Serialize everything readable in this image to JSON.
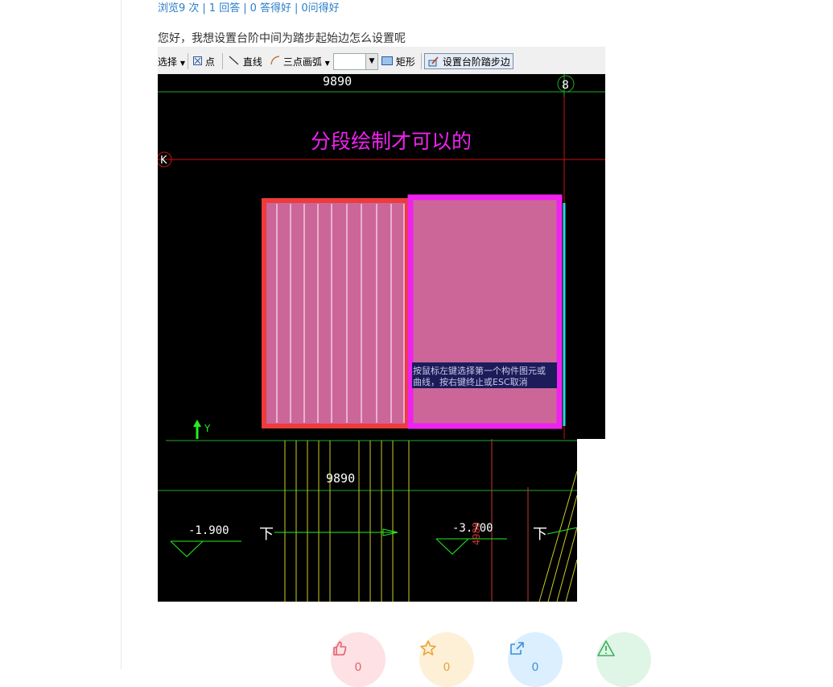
{
  "meta": {
    "views": "浏览9 次",
    "answers": "1 回答",
    "good_answers": "0 答得好",
    "got_good": "0问得好",
    "separator": "|"
  },
  "question": {
    "text": "您好，我想设置台阶中间为踏步起始边怎么设置呢"
  },
  "cad_toolbar": {
    "select_label": "选择",
    "point_label": "点",
    "line_label": "直线",
    "arc_label": "三点画弧",
    "rect_label": "矩形",
    "set_step_edge_label": "设置台阶踏步边",
    "dropdown_arrow": "▼"
  },
  "cad_view1": {
    "dimension": "9890",
    "axis_8": "8",
    "axis_k": "K",
    "annotation": "分段绘制才可以的",
    "prompt_line1": "按鼠标左键选择第一个构件图元或",
    "prompt_line2": "曲线，按右键终止或ESC取消",
    "y_axis_label": "Y",
    "colors": {
      "background": "#000000",
      "step_fill": "#cc6699",
      "left_border": "#ee3b3b",
      "right_border": "#ee22ee",
      "annotation": "#ee22ee",
      "grid_red": "#cc1111",
      "grid_green": "#22aa22",
      "cyan_edge": "#22dddd",
      "prompt_bg": "#1c1c5a"
    }
  },
  "cad_view2": {
    "dimension": "9890",
    "level_left": "-1.900",
    "level_right": "-3.700",
    "down_left": "下",
    "down_right": "下",
    "vertical_text": "4988"
  },
  "actions": [
    {
      "name": "like",
      "count": "0"
    },
    {
      "name": "favorite",
      "count": "0"
    },
    {
      "name": "share",
      "count": "0"
    },
    {
      "name": "report",
      "count": ""
    }
  ]
}
